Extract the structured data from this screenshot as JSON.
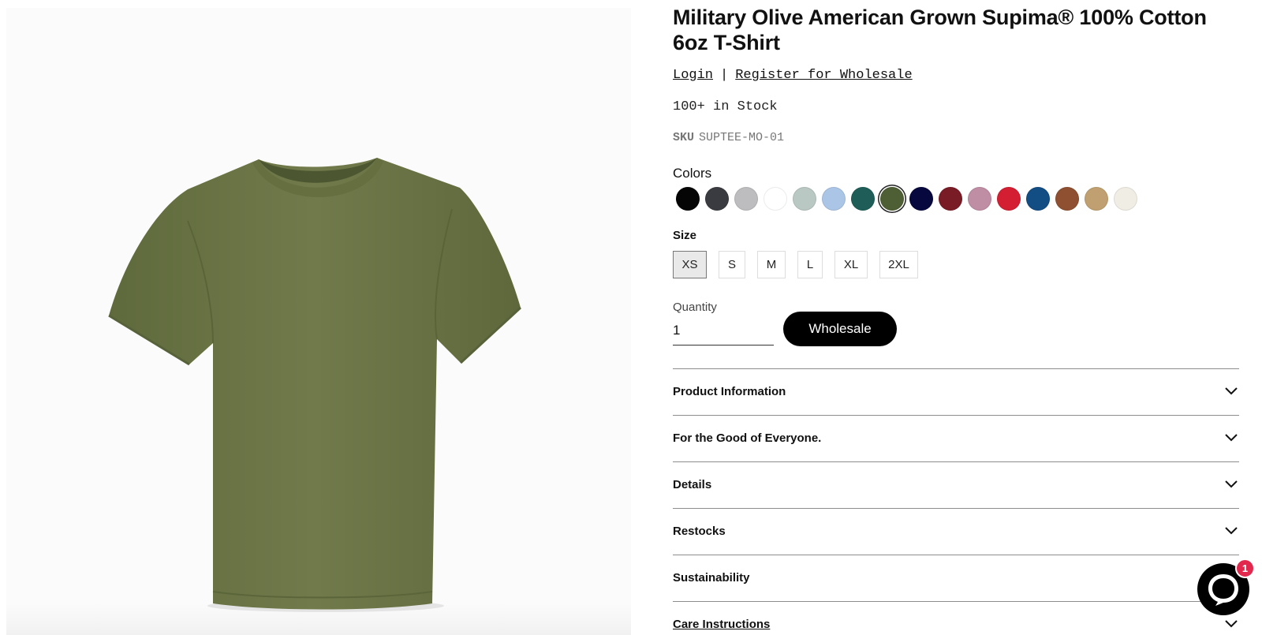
{
  "product": {
    "title": "Military Olive American Grown Supima® 100% Cotton 6oz T-Shirt",
    "image_subject": "tshirt-icon"
  },
  "account": {
    "login_label": "Login",
    "separator": "|",
    "register_label": "Register for Wholesale"
  },
  "stock_text": "100+ in Stock",
  "sku": {
    "label": "SKU",
    "value": "SUPTEE-MO-01"
  },
  "colors": {
    "label": "Colors",
    "swatches": [
      "#050505",
      "#3a3b40",
      "#bdbdbf",
      "#ffffff",
      "#b9c8c2",
      "#abc5e6",
      "#1f5e58",
      "#4f5f35",
      "#07083d",
      "#7a1c25",
      "#bf8ea4",
      "#d41f33",
      "#124d84",
      "#8e5030",
      "#c0a070",
      "#f0ede4"
    ],
    "selected_index": 7
  },
  "size": {
    "label": "Size",
    "options": [
      "XS",
      "S",
      "M",
      "L",
      "XL",
      "2XL"
    ],
    "selected": "XS"
  },
  "quantity": {
    "label": "Quantity",
    "value": "1"
  },
  "wholesale_button": "Wholesale",
  "accordion": [
    {
      "label": "Product Information"
    },
    {
      "label": "For the Good of Everyone."
    },
    {
      "label": "Details"
    },
    {
      "label": "Restocks"
    },
    {
      "label": "Sustainability"
    },
    {
      "label": "Care Instructions"
    }
  ],
  "chat": {
    "icon": "chat-bubble-icon",
    "badge_count": "1"
  },
  "theme": {
    "shirt_color": "#6e7547",
    "accent": "#000000",
    "badge_color": "#e2284d"
  }
}
